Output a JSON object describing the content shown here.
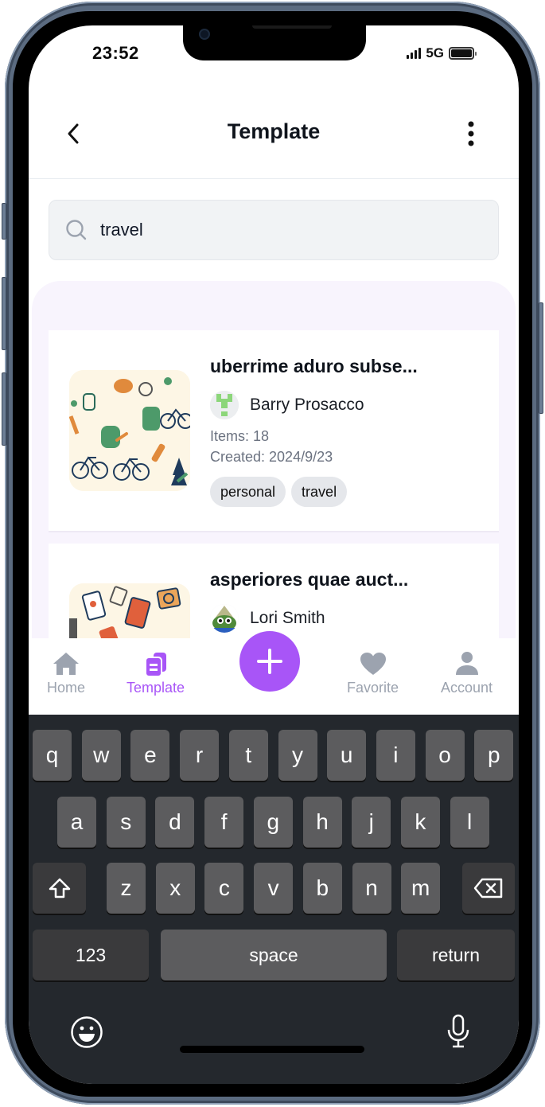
{
  "status_bar": {
    "time": "23:52",
    "network": "5G"
  },
  "nav": {
    "title": "Template",
    "back_icon": "chevron-left-icon",
    "more_icon": "more-vertical-icon"
  },
  "search": {
    "value": "travel",
    "placeholder": "",
    "icon": "search-icon"
  },
  "templates": [
    {
      "title": "uberrime aduro subse...",
      "author": "Barry Prosacco",
      "items": "Items: 18",
      "created": "Created: 2024/9/23",
      "tags": [
        "personal",
        "travel"
      ]
    },
    {
      "title": "asperiores quae auct...",
      "author": "Lori Smith"
    }
  ],
  "tab_bar": {
    "items": [
      {
        "label": "Home",
        "icon": "home-icon",
        "active": false
      },
      {
        "label": "Template",
        "icon": "template-icon",
        "active": true
      },
      {
        "label": "Favorite",
        "icon": "heart-icon",
        "active": false
      },
      {
        "label": "Account",
        "icon": "user-icon",
        "active": false
      }
    ],
    "fab_icon": "plus-icon"
  },
  "colors": {
    "accent": "#a855f7",
    "inactive": "#9ca3af",
    "results_bg": "#f8f4fd",
    "keyboard_bg": "#24282d"
  },
  "keyboard": {
    "row1": [
      "q",
      "w",
      "e",
      "r",
      "t",
      "y",
      "u",
      "i",
      "o",
      "p"
    ],
    "row2": [
      "a",
      "s",
      "d",
      "f",
      "g",
      "h",
      "j",
      "k",
      "l"
    ],
    "row3": [
      "z",
      "x",
      "c",
      "v",
      "b",
      "n",
      "m"
    ],
    "numbers_label": "123",
    "space_label": "space",
    "return_label": "return"
  }
}
